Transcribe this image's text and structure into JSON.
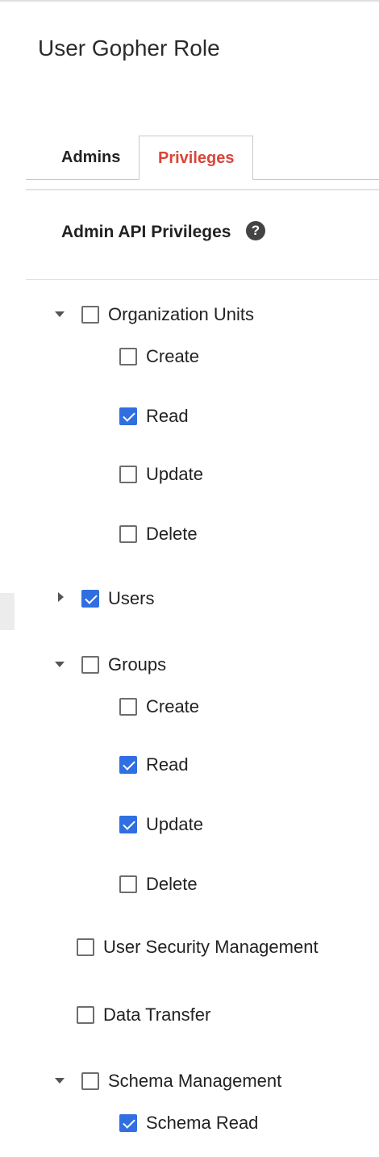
{
  "header": {
    "title": "User Gopher Role"
  },
  "tabs": [
    {
      "label": "Admins"
    },
    {
      "label": "Privileges"
    }
  ],
  "section": {
    "title": "Admin API Privileges",
    "help_glyph": "?"
  },
  "privileges": {
    "org_units": {
      "label": "Organization Units",
      "expanded": true,
      "checked": false,
      "children": {
        "create": "Create",
        "read": "Read",
        "update": "Update",
        "delete": "Delete"
      }
    },
    "users": {
      "label": "Users",
      "expanded": false,
      "checked": true
    },
    "groups": {
      "label": "Groups",
      "expanded": true,
      "checked": false,
      "children": {
        "create": "Create",
        "read": "Read",
        "update": "Update",
        "delete": "Delete"
      }
    },
    "user_security": {
      "label": "User Security Management",
      "checked": false
    },
    "data_transfer": {
      "label": "Data Transfer",
      "checked": false
    },
    "schema": {
      "label": "Schema Management",
      "expanded": true,
      "checked": false,
      "children": {
        "schema_read": "Schema Read"
      }
    }
  },
  "checked_items": [
    "org_units.read",
    "users",
    "groups.read",
    "groups.update",
    "schema.schema_read"
  ],
  "colors": {
    "accent": "#d9453a",
    "checkbox_checked": "#2f6fe2"
  },
  "icons": {
    "help": "help-circle-icon",
    "expand": "triangle-down-icon",
    "collapse": "triangle-right-icon"
  }
}
